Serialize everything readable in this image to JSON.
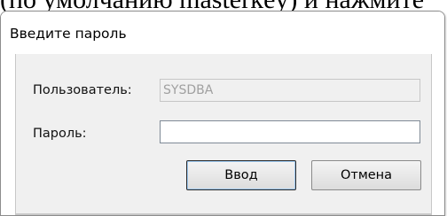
{
  "background": {
    "text": "(по умолчанию masterkey) и нажмите"
  },
  "dialog": {
    "title": "Введите пароль",
    "user": {
      "label": "Пользователь:",
      "value": "SYSDBA"
    },
    "password": {
      "label": "Пароль:",
      "value": ""
    },
    "buttons": {
      "ok": "Ввод",
      "cancel": "Отмена"
    }
  }
}
